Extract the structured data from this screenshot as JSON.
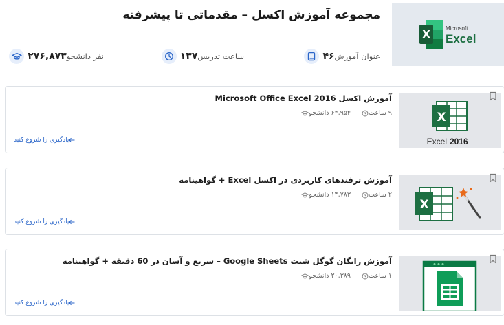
{
  "header": {
    "title": "مجموعه آموزش اکسل – مقدماتی تا پیشرفته",
    "logo_word": "Excel",
    "logo_brand": "Microsoft",
    "stats": [
      {
        "icon": "book-icon",
        "value": "۴۶",
        "label": "عنوان آموزش"
      },
      {
        "icon": "clock-icon",
        "value": "۱۳۷",
        "label": "ساعت تدریس"
      },
      {
        "icon": "graduation-cap-icon",
        "value": "۲۷۶,۸۷۳",
        "label": "نفر دانشجو"
      }
    ]
  },
  "courses": [
    {
      "title": "آموزش اکسل Microsoft Office Excel 2016",
      "students": "۶۴,۹۵۴ دانشجو",
      "hours": "۹ ساعت",
      "cta": "یادگیری را شروع کنید",
      "thumb_caption": "Excel",
      "thumb_caption_bold": "2016"
    },
    {
      "title": "آموزش ترفندهای کاربردی در اکسل Excel + گواهینامه",
      "students": "۱۴,۷۸۳ دانشجو",
      "hours": "۲ ساعت",
      "cta": "یادگیری را شروع کنید"
    },
    {
      "title": "آموزش رایگان گوگل شیت Google Sheets – سریع و آسان در 60 دقیقه + گواهینامه",
      "students": "۲۰,۳۸۹ دانشجو",
      "hours": "۱ ساعت",
      "cta": "یادگیری را شروع کنید"
    }
  ],
  "colors": {
    "excel_green": "#1d6f42",
    "accent_blue": "#2b66c9",
    "sheets_green": "#0f9d58"
  }
}
